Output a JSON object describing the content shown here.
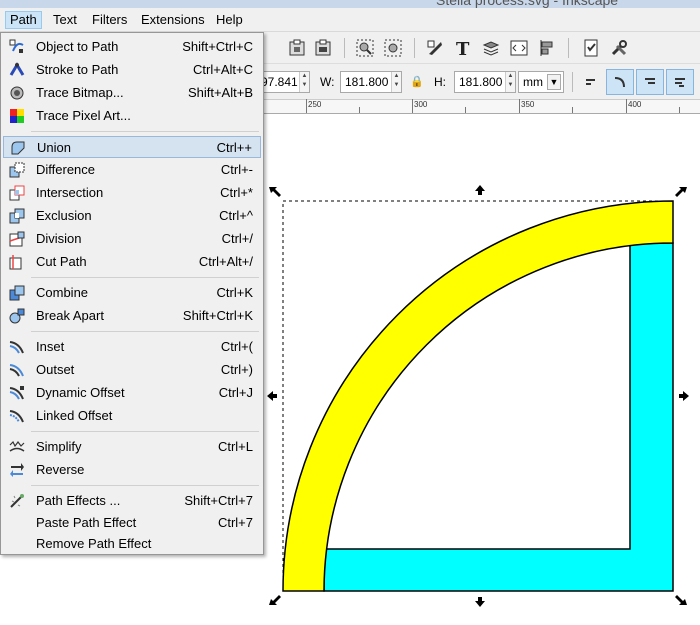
{
  "window": {
    "title": "Stella process.svg - Inkscape"
  },
  "menubar": {
    "items": [
      {
        "label": "Path",
        "active": true
      },
      {
        "label": "Text"
      },
      {
        "label": "Filters"
      },
      {
        "label": "Extensions"
      },
      {
        "label": "Help"
      }
    ]
  },
  "toolbar2": {
    "x_value": "97.841",
    "w_label": "W:",
    "w_value": "181.800",
    "h_label": "H:",
    "h_value": "181.800",
    "unit": "mm"
  },
  "ruler": {
    "ticks": [
      "250",
      "300",
      "350",
      "400"
    ]
  },
  "path_menu": {
    "items": [
      {
        "label": "Object to Path",
        "shortcut": "Shift+Ctrl+C",
        "icon": "object-to-path-icon"
      },
      {
        "label": "Stroke to Path",
        "shortcut": "Ctrl+Alt+C",
        "icon": "stroke-to-path-icon"
      },
      {
        "label": "Trace Bitmap...",
        "shortcut": "Shift+Alt+B",
        "icon": "trace-bitmap-icon"
      },
      {
        "label": "Trace Pixel Art...",
        "shortcut": "",
        "icon": "trace-pixel-art-icon"
      },
      {
        "label": "Union",
        "shortcut": "Ctrl++",
        "icon": "union-icon",
        "highlighted": true
      },
      {
        "label": "Difference",
        "shortcut": "Ctrl+-",
        "icon": "difference-icon"
      },
      {
        "label": "Intersection",
        "shortcut": "Ctrl+*",
        "icon": "intersection-icon"
      },
      {
        "label": "Exclusion",
        "shortcut": "Ctrl+^",
        "icon": "exclusion-icon"
      },
      {
        "label": "Division",
        "shortcut": "Ctrl+/",
        "icon": "division-icon"
      },
      {
        "label": "Cut Path",
        "shortcut": "Ctrl+Alt+/",
        "icon": "cut-path-icon"
      },
      {
        "label": "Combine",
        "shortcut": "Ctrl+K",
        "icon": "combine-icon"
      },
      {
        "label": "Break Apart",
        "shortcut": "Shift+Ctrl+K",
        "icon": "break-apart-icon"
      },
      {
        "label": "Inset",
        "shortcut": "Ctrl+(",
        "icon": "inset-icon"
      },
      {
        "label": "Outset",
        "shortcut": "Ctrl+)",
        "icon": "outset-icon"
      },
      {
        "label": "Dynamic Offset",
        "shortcut": "Ctrl+J",
        "icon": "dynamic-offset-icon"
      },
      {
        "label": "Linked Offset",
        "shortcut": "",
        "icon": "linked-offset-icon"
      },
      {
        "label": "Simplify",
        "shortcut": "Ctrl+L",
        "icon": "simplify-icon"
      },
      {
        "label": "Reverse",
        "shortcut": "",
        "icon": "reverse-icon"
      },
      {
        "label": "Path Effects ...",
        "shortcut": "Shift+Ctrl+7",
        "icon": "path-effects-icon"
      },
      {
        "label": "Paste Path Effect",
        "shortcut": "Ctrl+7",
        "icon": ""
      },
      {
        "label": "Remove Path Effect",
        "shortcut": "",
        "icon": ""
      }
    ]
  },
  "colors": {
    "yellow_shape": "#ffff00",
    "cyan_shape": "#00ffff",
    "menu_highlight": "#d5e3f1"
  }
}
